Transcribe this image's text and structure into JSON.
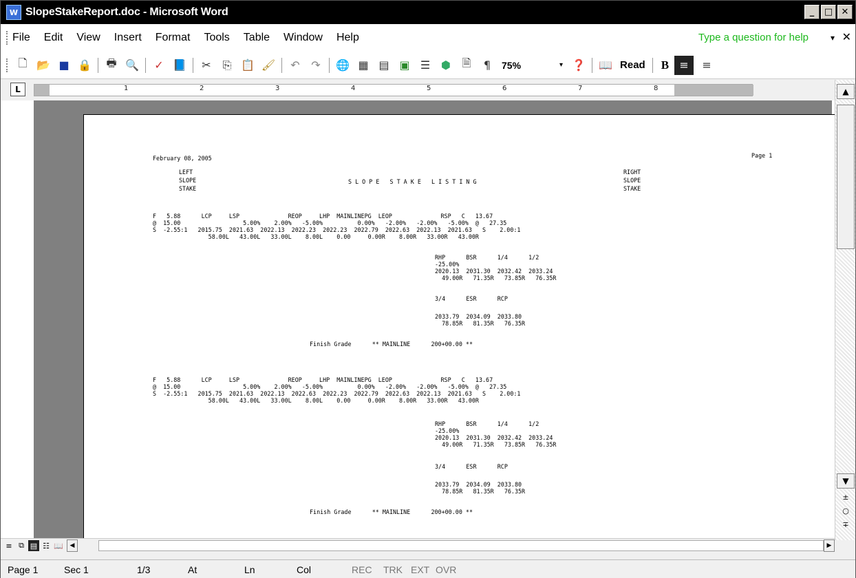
{
  "window": {
    "title": "SlopeStakeReport.doc - Microsoft Word",
    "app_icon": "word-icon",
    "buttons": [
      "_",
      "□",
      "✕"
    ]
  },
  "menubar": {
    "items": [
      "File",
      "Edit",
      "View",
      "Insert",
      "Format",
      "Tools",
      "Table",
      "Window",
      "Help"
    ],
    "help_question": "Type a question for help",
    "help_arrow": "▾",
    "close_glyph": "✕"
  },
  "toolbar": {
    "zoom": "75%",
    "zoom_arrow": "▾",
    "read_label": "Read",
    "bold_label": "B"
  },
  "ruler": {
    "numbers": [
      "1",
      "2",
      "3",
      "4",
      "5",
      "6",
      "7",
      "8"
    ]
  },
  "document": {
    "date": "February 08, 2005",
    "page_label": "Page 1",
    "left_header": [
      "LEFT",
      "SLOPE",
      "STAKE"
    ],
    "right_header": [
      "RIGHT",
      "SLOPE",
      "STAKE"
    ],
    "listing_title": "S L O P E   S T A K E   L I S T I N G",
    "blocks": [
      {
        "rows": [
          "F   5.88      LCP     LSP              REOP     LHP  MAINLINEPG  LEOP              RSP   C   13.67",
          "@  15.00                  5.00%    2.00%   -5.00%          0.00%   -2.00%   -2.00%   -5.00%  @   27.35",
          "S  -2.55:1   2015.75  2021.63  2022.13  2022.23  2022.23  2022.79  2022.63  2022.13  2021.63   S    2.00:1",
          "                58.00L   43.00L   33.00L    8.00L    0.00     0.00R    8.00R   33.00R   43.00R"
        ],
        "sub1": [
          "RHP      BSR      1/4      1/2",
          "-25.00%",
          "2020.13  2031.30  2032.42  2033.24",
          "  49.00R   71.35R   73.85R   76.35R"
        ],
        "sub2": [
          "3/4      ESR      RCP",
          "",
          "2033.79  2034.09  2033.80",
          "  78.85R   81.35R   76.35R"
        ],
        "finish": "Finish Grade      ** MAINLINE      200+00.00 **"
      },
      {
        "rows": [
          "F   5.88      LCP     LSP              REOP     LHP  MAINLINEPG  LEOP              RSP   C   13.67",
          "@  15.00                  5.00%    2.00%   -5.00%          0.00%   -2.00%   -2.00%   -5.00%  @   27.35",
          "S  -2.55:1   2015.75  2021.63  2022.13  2022.63  2022.23  2022.79  2022.63  2022.13  2021.63   S    2.00:1",
          "                58.00L   43.00L   33.00L    8.00L    0.00     0.00R    8.00R   33.00R   43.00R"
        ],
        "sub1": [
          "RHP      BSR      1/4      1/2",
          "-25.00%",
          "2020.13  2031.30  2032.42  2033.24",
          "  49.00R   71.35R   73.85R   76.35R"
        ],
        "sub2": [
          "3/4      ESR      RCP",
          "",
          "2033.79  2034.09  2033.80",
          "  78.85R   81.35R   76.35R"
        ],
        "finish": "Finish Grade      ** MAINLINE      200+00.00 **"
      }
    ]
  },
  "statusbar": {
    "page": "Page 1",
    "sec": "Sec 1",
    "pages": "1/3",
    "at": "At",
    "ln": "Ln",
    "col": "Col",
    "rec": "REC",
    "trk": "TRK",
    "ext": "EXT",
    "ovr": "OVR"
  }
}
